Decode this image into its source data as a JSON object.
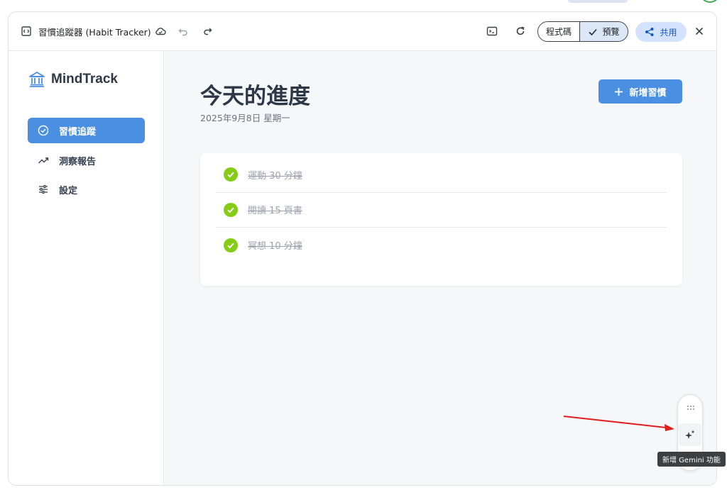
{
  "toolbar": {
    "title": "習慣追蹤器 (Habit Tracker)",
    "code_label": "程式碼",
    "preview_label": "預覽",
    "share_label": "共用"
  },
  "sidebar": {
    "brand": "MindTrack",
    "items": [
      {
        "label": "習慣追蹤",
        "icon": "check-circle-icon",
        "active": true
      },
      {
        "label": "洞察報告",
        "icon": "trending-up-icon",
        "active": false
      },
      {
        "label": "設定",
        "icon": "sliders-icon",
        "active": false
      }
    ]
  },
  "main": {
    "title": "今天的進度",
    "date": "2025年9月8日 星期一",
    "add_button": "新增習慣",
    "habits": [
      {
        "label": "運動 30 分鐘",
        "done": true
      },
      {
        "label": "閱讀 15 頁書",
        "done": true
      },
      {
        "label": "冥想 10 分鐘",
        "done": true
      }
    ]
  },
  "floating": {
    "tooltip": "新增 Gemini 功能"
  },
  "colors": {
    "accent": "#4a8fe2",
    "done": "#84cc16",
    "share_bg": "#d3e3fd",
    "annotation_arrow": "#e11d1d"
  }
}
